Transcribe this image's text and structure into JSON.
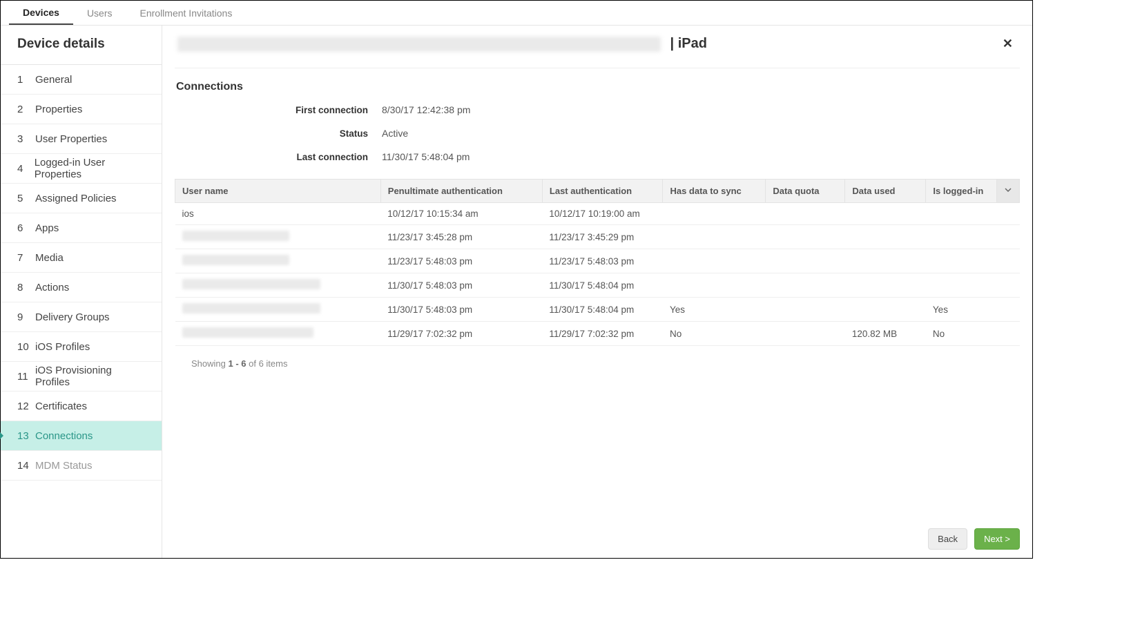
{
  "topTabs": [
    {
      "label": "Devices",
      "active": true
    },
    {
      "label": "Users",
      "active": false
    },
    {
      "label": "Enrollment Invitations",
      "active": false
    }
  ],
  "sidebar": {
    "title": "Device details",
    "items": [
      {
        "num": "1",
        "label": "General"
      },
      {
        "num": "2",
        "label": "Properties"
      },
      {
        "num": "3",
        "label": "User Properties"
      },
      {
        "num": "4",
        "label": "Logged-in User Properties"
      },
      {
        "num": "5",
        "label": "Assigned Policies"
      },
      {
        "num": "6",
        "label": "Apps"
      },
      {
        "num": "7",
        "label": "Media"
      },
      {
        "num": "8",
        "label": "Actions"
      },
      {
        "num": "9",
        "label": "Delivery Groups"
      },
      {
        "num": "10",
        "label": "iOS Profiles"
      },
      {
        "num": "11",
        "label": "iOS Provisioning Profiles"
      },
      {
        "num": "12",
        "label": "Certificates"
      },
      {
        "num": "13",
        "label": "Connections"
      },
      {
        "num": "14",
        "label": "MDM Status"
      }
    ],
    "activeIndex": 12
  },
  "header": {
    "deviceLabel": " | iPad"
  },
  "connections": {
    "title": "Connections",
    "fields": [
      {
        "label": "First connection",
        "value": "8/30/17 12:42:38 pm"
      },
      {
        "label": "Status",
        "value": "Active"
      },
      {
        "label": "Last connection",
        "value": "11/30/17 5:48:04 pm"
      }
    ],
    "columns": [
      "User name",
      "Penultimate authentication",
      "Last authentication",
      "Has data to sync",
      "Data quota",
      "Data used",
      "Is logged-in"
    ],
    "rows": [
      {
        "user": "ios",
        "pen": "10/12/17 10:15:34 am",
        "last": "10/12/17 10:19:00 am",
        "sync": "",
        "quota": "",
        "used": "",
        "logged": ""
      },
      {
        "user": "",
        "pen": "11/23/17 3:45:28 pm",
        "last": "11/23/17 3:45:29 pm",
        "sync": "",
        "quota": "",
        "used": "",
        "logged": ""
      },
      {
        "user": "",
        "pen": "11/23/17 5:48:03 pm",
        "last": "11/23/17 5:48:03 pm",
        "sync": "",
        "quota": "",
        "used": "",
        "logged": ""
      },
      {
        "user": "",
        "pen": "11/30/17 5:48:03 pm",
        "last": "11/30/17 5:48:04 pm",
        "sync": "",
        "quota": "",
        "used": "",
        "logged": ""
      },
      {
        "user": "",
        "pen": "11/30/17 5:48:03 pm",
        "last": "11/30/17 5:48:04 pm",
        "sync": "Yes",
        "quota": "",
        "used": "",
        "logged": "Yes"
      },
      {
        "user": "",
        "pen": "11/29/17 7:02:32 pm",
        "last": "11/29/17 7:02:32 pm",
        "sync": "No",
        "quota": "",
        "used": "120.82 MB",
        "logged": "No"
      }
    ],
    "redactedWidths": [
      0,
      155,
      155,
      200,
      200,
      190
    ],
    "pager": {
      "prefix": "Showing ",
      "range": "1 - 6",
      "suffix": " of 6 items"
    }
  },
  "footer": {
    "back": "Back",
    "next": "Next >"
  }
}
